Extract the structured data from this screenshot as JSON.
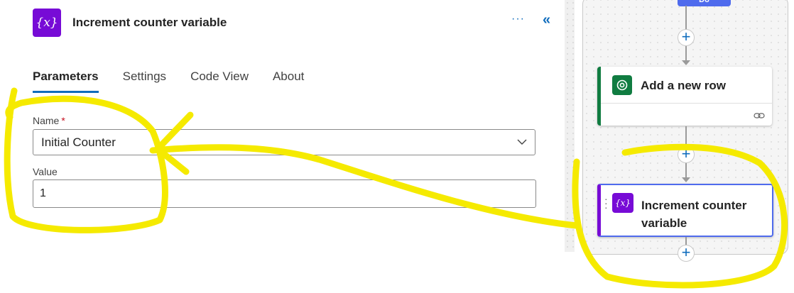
{
  "panel": {
    "title": "Increment counter variable",
    "icon": "variable-icon",
    "more_label": "···",
    "collapse_label": "«",
    "tabs": [
      {
        "label": "Parameters",
        "active": true
      },
      {
        "label": "Settings",
        "active": false
      },
      {
        "label": "Code View",
        "active": false
      },
      {
        "label": "About",
        "active": false
      }
    ],
    "fields": {
      "name_label": "Name",
      "name_required_mark": "*",
      "name_value": "Initial Counter",
      "value_label": "Value",
      "value_value": "1"
    }
  },
  "canvas": {
    "scope_label": "Do",
    "cards": [
      {
        "title": "Add a new row",
        "icon": "dataverse-icon",
        "color": "#107c41"
      },
      {
        "title": "Increment counter variable",
        "icon": "variable-icon",
        "color": "#770bd6"
      }
    ],
    "add_step_label": "+"
  },
  "colors": {
    "accent": "#0f6cbd",
    "variable_purple": "#770bd6",
    "dataverse_green": "#107c41",
    "highlighter": "#f5ea00"
  }
}
